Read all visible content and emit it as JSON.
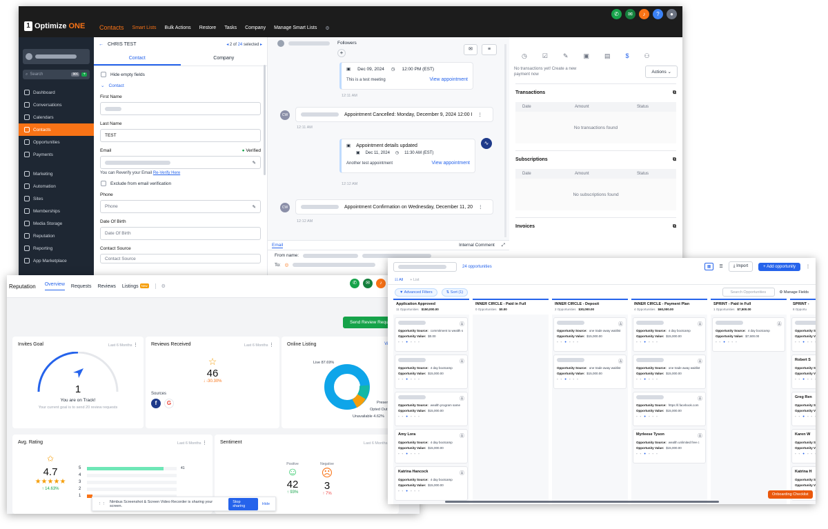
{
  "crm": {
    "logo": {
      "brand": "Optimize",
      "brand_accent": "ONE"
    },
    "nav": [
      "Contacts",
      "Smart Lists",
      "Bulk Actions",
      "Restore",
      "Tasks",
      "Company",
      "Manage Smart Lists"
    ],
    "search_placeholder": "Search",
    "menu": [
      {
        "label": "Dashboard",
        "icon": "grid-icon"
      },
      {
        "label": "Conversations",
        "icon": "chat-icon"
      },
      {
        "label": "Calendars",
        "icon": "calendar-icon"
      },
      {
        "label": "Contacts",
        "icon": "contacts-icon",
        "active": true
      },
      {
        "label": "Opportunities",
        "icon": "funnel-icon"
      },
      {
        "label": "Payments",
        "icon": "card-icon"
      },
      {
        "label": "Marketing",
        "icon": "send-icon"
      },
      {
        "label": "Automation",
        "icon": "automation-icon"
      },
      {
        "label": "Sites",
        "icon": "sites-icon"
      },
      {
        "label": "Memberships",
        "icon": "membership-icon"
      },
      {
        "label": "Media Storage",
        "icon": "media-icon"
      },
      {
        "label": "Reputation",
        "icon": "star-icon"
      },
      {
        "label": "Reporting",
        "icon": "chart-icon"
      },
      {
        "label": "App Marketplace",
        "icon": "apps-icon"
      }
    ],
    "contact": {
      "name": "CHRIS TEST",
      "pager_current": "2",
      "pager_of": "of",
      "pager_total": "24",
      "pager_suffix": "selected",
      "tabs": [
        "Contact",
        "Company"
      ],
      "hide_empty": "Hide empty fields",
      "section": "Contact",
      "first_name_label": "First Name",
      "last_name_label": "Last Name",
      "last_name_value": "TEST",
      "email_label": "Email",
      "verified": "Verified",
      "reverify_text": "You can Reverify your Email",
      "reverify_link": "Re-Verify Here",
      "exclude": "Exclude from email verification",
      "phone_label": "Phone",
      "phone_placeholder": "Phone",
      "dob_label": "Date Of Birth",
      "dob_placeholder": "Date Of Birth",
      "source_label": "Contact Source",
      "source_placeholder": "Contact Source"
    },
    "conversation": {
      "followers": "Followers",
      "card1": {
        "date": "Dec 09, 2024",
        "time": "12:00 PM (EST)",
        "note": "This is a test meeting",
        "link": "View appointment"
      },
      "time1": "12:11 AM",
      "cancel_msg": "Appointment Cancelled: Monday, December 9, 2024 12:00 I",
      "time2": "12:11 AM",
      "card2": {
        "title": "Appointment details updated",
        "date": "Dec 11, 2024",
        "time": "11:30 AM (EST)",
        "note": "Another test appointment",
        "link": "View appointment"
      },
      "time3": "12:12 AM",
      "confirm_msg": "Appointment Confirmation on Wednesday, December 11, 20",
      "time4": "12:12 AM",
      "tab_email": "Email",
      "tab_internal": "Internal Comment",
      "from_label": "From name:",
      "to_label": "To:"
    },
    "payments": {
      "no_tx_note": "No transactions yet! Create a new payment now",
      "actions": "Actions",
      "transactions": "Transactions",
      "cols": [
        "Date",
        "Amount",
        "Status"
      ],
      "no_tx": "No transactions found",
      "subscriptions": "Subscriptions",
      "no_sub": "No subscriptions found",
      "invoices": "Invoices"
    }
  },
  "reputation": {
    "title": "Reputation",
    "tabs": [
      "Overview",
      "Requests",
      "Reviews",
      "Listings"
    ],
    "new_badge": "New",
    "send_button": "Send Review Requ",
    "invites": {
      "title": "Invites Goal",
      "period": "Last 6 Months",
      "value": "1",
      "status": "You are on Track!",
      "note": "Your current goal is to send 20 review requests"
    },
    "received": {
      "title": "Reviews Received",
      "period": "Last 6 Months",
      "value": "46",
      "change": "-30.30%",
      "sources": "Sources"
    },
    "listing": {
      "title": "Online Listing",
      "view": "View",
      "live": "Live 87.69%",
      "present": "Presen",
      "opted_out": "Opted Out",
      "unavailable": "Unavailable 4.62%"
    },
    "rating": {
      "title": "Avg. Rating",
      "period": "Last 6 Months",
      "value": "4.7",
      "stars": "★★★★★",
      "change": "14.63%",
      "bars": [
        {
          "label": "5",
          "count": "41",
          "fill": 0.85
        },
        {
          "label": "4",
          "count": "",
          "fill": 0
        },
        {
          "label": "3",
          "count": "",
          "fill": 0
        },
        {
          "label": "2",
          "count": "",
          "fill": 0
        },
        {
          "label": "1",
          "count": "",
          "fill": 0.06
        }
      ]
    },
    "sentiment": {
      "title": "Sentiment",
      "period": "Last 6 Months",
      "pos_label": "Positive",
      "neg_label": "Negative",
      "pos_value": "42",
      "neg_value": "3",
      "pos_change": "93%",
      "neg_change": "7%"
    },
    "share_bar": {
      "text": "Nimbus Screenshot & Screen Video Recorder is sharing your screen.",
      "stop": "Stop sharing",
      "hide": "Hide"
    }
  },
  "opportunities": {
    "count": "24 opportunities",
    "import": "Import",
    "add": "+ Add opportunity",
    "tab_all": "All",
    "tab_list": "List",
    "advanced_filters": "Advanced Filters",
    "sort": "Sort (1)",
    "search_placeholder": "Search Opportunities",
    "manage_fields": "Manage Fields",
    "columns": [
      {
        "name": "Application Approved",
        "count": "11 Opportunities",
        "value": "$150,000.00",
        "cards": [
          {
            "name": "",
            "source": "commitment to wealth s",
            "value": "$0.00"
          },
          {
            "name": "",
            "source": "4 day bootcamp",
            "value": "$15,000.00"
          },
          {
            "name": "",
            "source": "wealth program same",
            "value": "$15,000.00"
          },
          {
            "name": "Amy Lora",
            "source": "4 day bootcamp",
            "value": "$15,000.00"
          },
          {
            "name": "Katrina Hancock",
            "source": "4 day bootcamp",
            "value": "$15,000.00"
          }
        ]
      },
      {
        "name": "INNER CIRCLE - Paid in Full",
        "count": "0 Opportunities",
        "value": "$0.00",
        "cards": []
      },
      {
        "name": "INNER CIRCLE - Deposit",
        "count": "2 Opportunities",
        "value": "$30,000.00",
        "cards": [
          {
            "name": "",
            "source": "one trade away waitlist",
            "value": "$15,000.00"
          },
          {
            "name": "",
            "source": "one trade away waitlist",
            "value": "$15,000.00"
          }
        ]
      },
      {
        "name": "INNER CIRCLE - Payment Plan",
        "count": "4 Opportunities",
        "value": "$60,000.00",
        "cards": [
          {
            "name": "",
            "source": "4 day bootcamp",
            "value": "$15,000.00"
          },
          {
            "name": "",
            "source": "one trade away waitlist",
            "value": "$15,000.00"
          },
          {
            "name": "",
            "source": "https://l.facebook.com",
            "value": "$15,000.00"
          },
          {
            "name": "Myrleese Tyson",
            "source": "wealth unlimited free c",
            "value": "$15,000.00"
          }
        ]
      },
      {
        "name": "SPRINT - Paid in Full",
        "count": "1 Opportunities",
        "value": "$7,500.00",
        "cards": [
          {
            "name": "",
            "source": "4 day bootcamp",
            "value": "$7,500.00"
          }
        ]
      },
      {
        "name": "SPRINT -",
        "count": "8 Opportu",
        "value": "",
        "cards": [
          {
            "name": "",
            "source": "",
            "value": ""
          },
          {
            "name": "Robert S",
            "source": "",
            "value": ""
          },
          {
            "name": "Greg Ren",
            "source": "",
            "value": ""
          },
          {
            "name": "Karen W",
            "source": "",
            "value": ""
          },
          {
            "name": "Katrina H",
            "source": "",
            "value": ""
          }
        ]
      }
    ],
    "source_label": "Opportunity Source:",
    "value_label": "Opportunity Value:",
    "checklist": "Onboarding Checklist"
  }
}
